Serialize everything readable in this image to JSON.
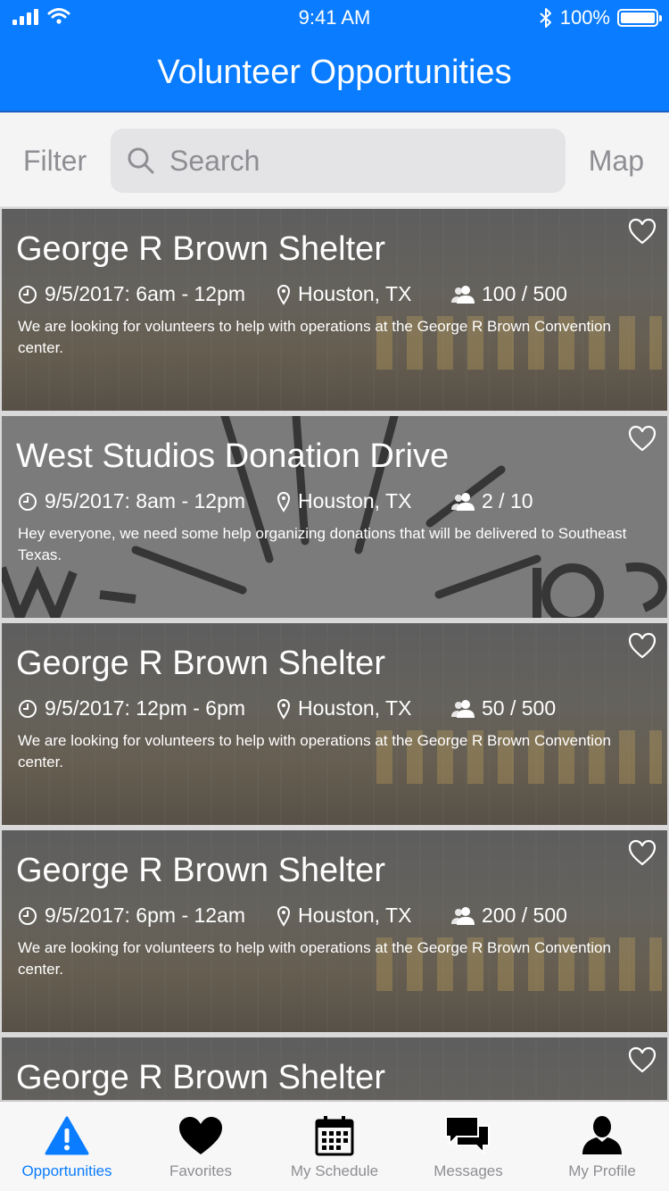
{
  "status_bar": {
    "time": "9:41 AM",
    "battery": "100%"
  },
  "nav": {
    "title": "Volunteer Opportunities"
  },
  "search": {
    "filter_label": "Filter",
    "placeholder": "Search",
    "map_label": "Map"
  },
  "opportunities": [
    {
      "title": "George R Brown Shelter",
      "datetime": "9/5/2017: 6am - 12pm",
      "location": "Houston, TX",
      "capacity": "100 / 500",
      "description": "We are looking for volunteers to help with operations at the George R Brown Convention center."
    },
    {
      "title": "West Studios Donation Drive",
      "datetime": "9/5/2017: 8am - 12pm",
      "location": "Houston, TX",
      "capacity": "2 / 10",
      "description": "Hey everyone, we need some help organizing donations that will be delivered to Southeast Texas."
    },
    {
      "title": "George R Brown Shelter",
      "datetime": "9/5/2017: 12pm - 6pm",
      "location": "Houston, TX",
      "capacity": "50 / 500",
      "description": "We are looking for volunteers to help with operations at the George R Brown Convention center."
    },
    {
      "title": "George R Brown Shelter",
      "datetime": "9/5/2017: 6pm - 12am",
      "location": "Houston, TX",
      "capacity": "200 / 500",
      "description": "We are looking for volunteers to help with operations at the George R Brown Convention center."
    },
    {
      "title": "George R Brown Shelter"
    }
  ],
  "tabs": [
    {
      "label": "Opportunities",
      "icon": "warning-icon",
      "active": true
    },
    {
      "label": "Favorites",
      "icon": "heart-icon",
      "active": false
    },
    {
      "label": "My Schedule",
      "icon": "calendar-icon",
      "active": false
    },
    {
      "label": "Messages",
      "icon": "chat-icon",
      "active": false
    },
    {
      "label": "My Profile",
      "icon": "person-icon",
      "active": false
    }
  ],
  "colors": {
    "accent": "#0a7cff",
    "inactive": "#8e8e93"
  }
}
